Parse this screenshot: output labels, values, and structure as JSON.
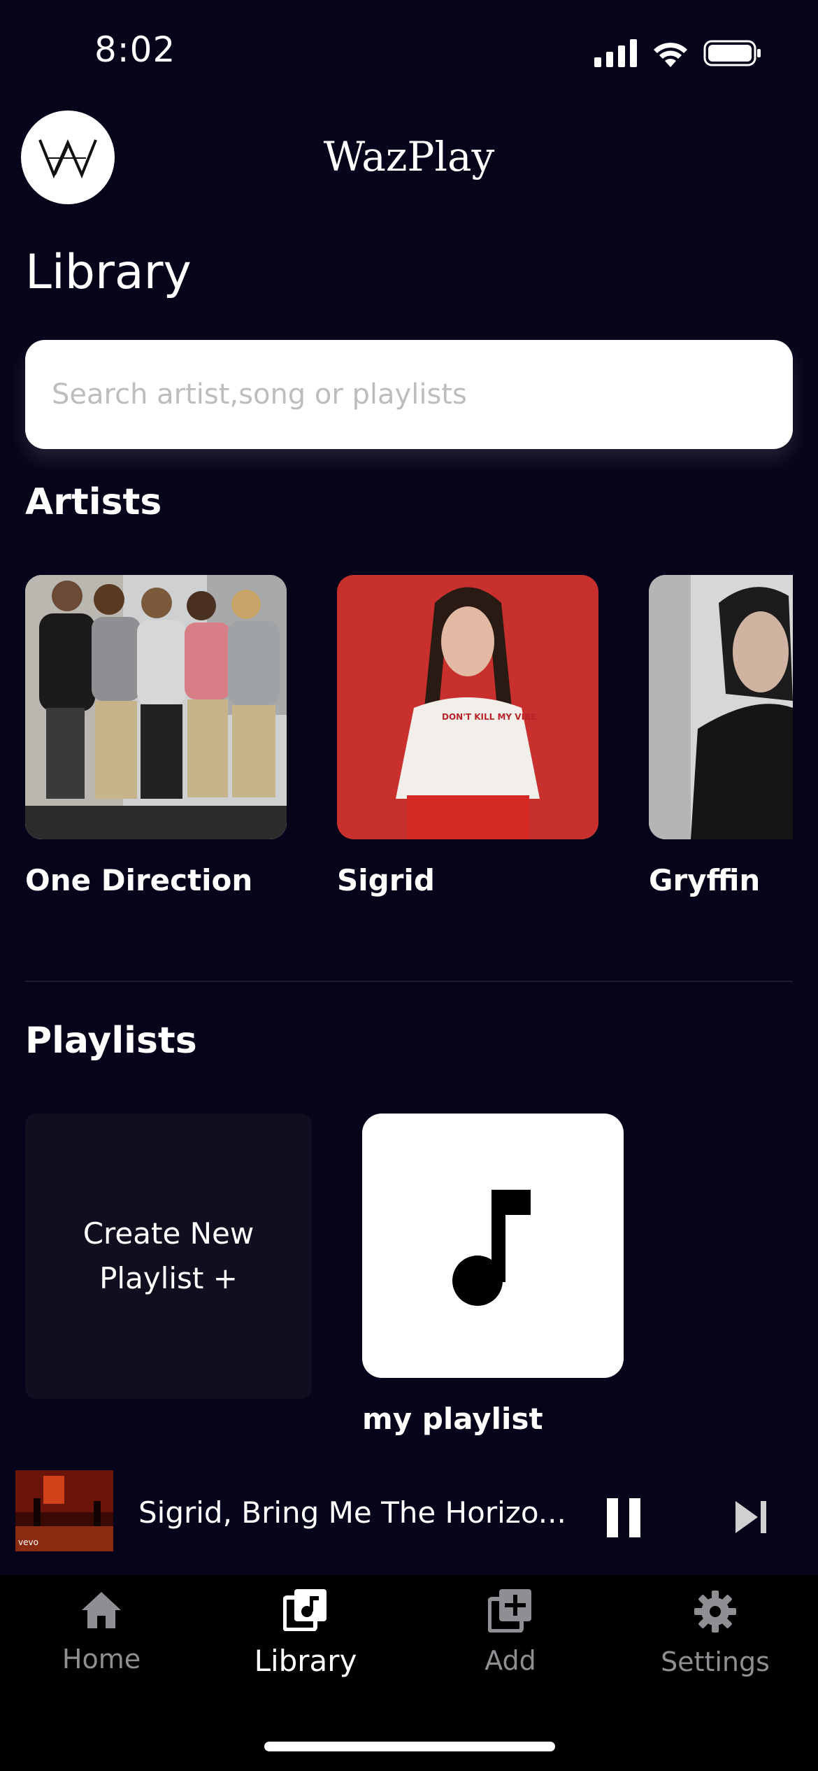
{
  "status_bar": {
    "time": "8:02"
  },
  "header": {
    "logo_text": "W",
    "app_title": "WazPlay"
  },
  "page": {
    "title": "Library"
  },
  "search": {
    "placeholder": "Search artist,song or playlists"
  },
  "artists": {
    "section_title": "Artists",
    "items": [
      {
        "name": "One Direction"
      },
      {
        "name": "Sigrid"
      },
      {
        "name": "Gryffin"
      }
    ],
    "shirt_text": "DON'T KILL MY VIBE"
  },
  "playlists": {
    "section_title": "Playlists",
    "create_line1": "Create New",
    "create_line2": "Playlist +",
    "items": [
      {
        "name": "my playlist",
        "icon": "music-note-icon"
      }
    ]
  },
  "now_playing": {
    "title": "Sigrid, Bring Me The Horizo...",
    "thumb_label": "vevo",
    "state": "playing"
  },
  "bottom_nav": {
    "items": [
      {
        "label": "Home",
        "icon": "home-icon",
        "active": false
      },
      {
        "label": "Library",
        "icon": "library-icon",
        "active": true
      },
      {
        "label": "Add",
        "icon": "add-icon",
        "active": false
      },
      {
        "label": "Settings",
        "icon": "gear-icon",
        "active": false
      }
    ]
  },
  "colors": {
    "background": "#06041a",
    "nav_background": "#000000",
    "inactive": "#8e8e93",
    "card": "#100e1f"
  }
}
